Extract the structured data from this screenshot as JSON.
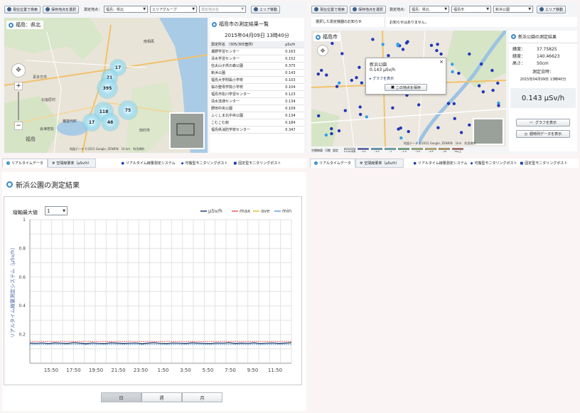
{
  "left": {
    "toolbar": {
      "current_location_label": "現在位置で検索",
      "saved_point_label": "保存地点を選択",
      "area_label": "測定地点：",
      "area_value": "福島：県北",
      "group_value": "エリアグループ",
      "point_placeholder": "測定地点名",
      "move_label": "エリア移動"
    },
    "map": {
      "title": "福島：県北",
      "clusters": [
        "17",
        "21",
        "395",
        "118",
        "75",
        "17",
        "48"
      ],
      "towns": [
        "福島",
        "喜多方市",
        "会津若松",
        "猪苗代町",
        "田村市",
        "北塩原村",
        "南相馬"
      ],
      "attribution": "地図データ ©2015 Google, ZENRIN　10 km　利用規約"
    },
    "list": {
      "title": "福島市の測定結果一覧",
      "date": "2015年04月09日 13時40分",
      "col_name": "測定所名 （305/305箇所）",
      "col_value": "μSv/h",
      "rows": [
        {
          "name": "瀬野学習センター",
          "value": "0.163"
        },
        {
          "name": "清水学習センター",
          "value": "0.152"
        },
        {
          "name": "信夫山子供の森公園",
          "value": "0.375"
        },
        {
          "name": "新浜公園",
          "value": "0.143"
        },
        {
          "name": "福島大学附属小学校",
          "value": "0.103"
        },
        {
          "name": "桜の聖母学院小学校",
          "value": "0.104"
        },
        {
          "name": "福島市松川学習センター",
          "value": "0.123"
        },
        {
          "name": "清水流通センター",
          "value": "0.134"
        },
        {
          "name": "野田中央公園",
          "value": "0.109"
        },
        {
          "name": "ふくしま北中央公園",
          "value": "0.134"
        },
        {
          "name": "こむこむ館",
          "value": "0.184"
        },
        {
          "name": "福島県消防学校センター",
          "value": "0.347"
        }
      ]
    },
    "tabs": {
      "realtime": "リアルタイムデータ",
      "dose_rate": "空間線量率（μSv/h）",
      "legend_realtime": "リアルタイム線量測定システム",
      "legend_portable": "可搬型モニタリングポスト",
      "legend_fixed": "固定型モニタリングポスト"
    }
  },
  "right": {
    "toolbar": {
      "current_location_label": "現在位置で検索",
      "saved_point_label": "保存地点を選択",
      "area_label": "測定地点：",
      "area_value": "福島：県北",
      "city_value": "福島市",
      "point_value": "新浜公園",
      "move_label": "エリア移動"
    },
    "notice": {
      "label": "選択した測定機器のお知らせ",
      "text": "お知らせはありません。"
    },
    "map": {
      "title": "福島市",
      "popup_name": "新浜公園",
      "popup_value": "0.143 μSv/h",
      "popup_link": "グラフを表示",
      "popup_button": "この地点を保存",
      "attribution": "地図データ ©2015 Google, ZENRIN　1km　利用規約"
    },
    "scale": {
      "labels": [
        "空間線量",
        "可搬",
        "固定"
      ],
      "steps": [
        "0.1μSv未満",
        "~0.2",
        "~0.5",
        "~1",
        "~1.9",
        "~3.8",
        "~9.5",
        "~19",
        "19以上"
      ]
    },
    "detail": {
      "title": "新浜公園の測定結果",
      "lat_label": "緯度：",
      "lat_value": "37.75825",
      "lng_label": "経度：",
      "lng_value": "140.46623",
      "height_label": "高さ：",
      "height_value": "50cm",
      "datetime_label": "測定日時：",
      "datetime_value": "2015年04月09日 13時40分",
      "big_value": "0.143 μSv/h",
      "graph_button": "グラフを表示",
      "history_button": "経時列データを表示"
    },
    "tabs": {
      "realtime": "リアルタイムデータ",
      "dose_rate": "空間線量率（μSv/h）",
      "legend_realtime": "リアルタイム線量測定システム",
      "legend_portable": "可搬型モニタリングポスト",
      "legend_fixed": "固定型モニタリングポスト"
    }
  },
  "graph": {
    "title": "新浜公園の測定結果",
    "ymax_label": "縦軸最大値",
    "ymax_value": "1",
    "segments": [
      "日",
      "週",
      "月"
    ],
    "colors": {
      "uSv": "#1f3a7a",
      "max": "#e06060",
      "ave": "#e0c030",
      "min": "#60a0e0"
    }
  },
  "chart_data": {
    "type": "line",
    "title": "",
    "xlabel": "",
    "ylabel": "リアルタイム線量測定システム（μSv/h）",
    "ylim": [
      0,
      1
    ],
    "yticks": [
      "0.2",
      "0.4",
      "0.6",
      "0.8",
      "1"
    ],
    "xticks": [
      "15:50",
      "17:50",
      "19:50",
      "21:50",
      "23:50",
      "1:50",
      "3:50",
      "5:50",
      "7:50",
      "9:50",
      "11:50"
    ],
    "legend_position": "top-right",
    "grid": true,
    "series": [
      {
        "name": "μSv/h",
        "values": [
          0.14,
          0.138,
          0.141,
          0.136,
          0.142,
          0.139,
          0.137,
          0.143,
          0.14,
          0.135,
          0.141,
          0.138,
          0.136,
          0.142,
          0.14,
          0.137,
          0.139,
          0.141,
          0.135,
          0.14,
          0.143,
          0.138,
          0.136,
          0.141,
          0.139,
          0.137,
          0.142,
          0.14,
          0.138,
          0.136,
          0.141,
          0.139,
          0.143,
          0.137,
          0.14,
          0.138,
          0.142,
          0.136,
          0.139,
          0.141,
          0.137,
          0.14,
          0.143
        ]
      },
      {
        "name": "max",
        "values": [
          0.152,
          0.152
        ]
      },
      {
        "name": "ave",
        "values": [
          0.139,
          0.139
        ]
      },
      {
        "name": "min",
        "values": [
          0.13,
          0.13
        ]
      }
    ]
  }
}
